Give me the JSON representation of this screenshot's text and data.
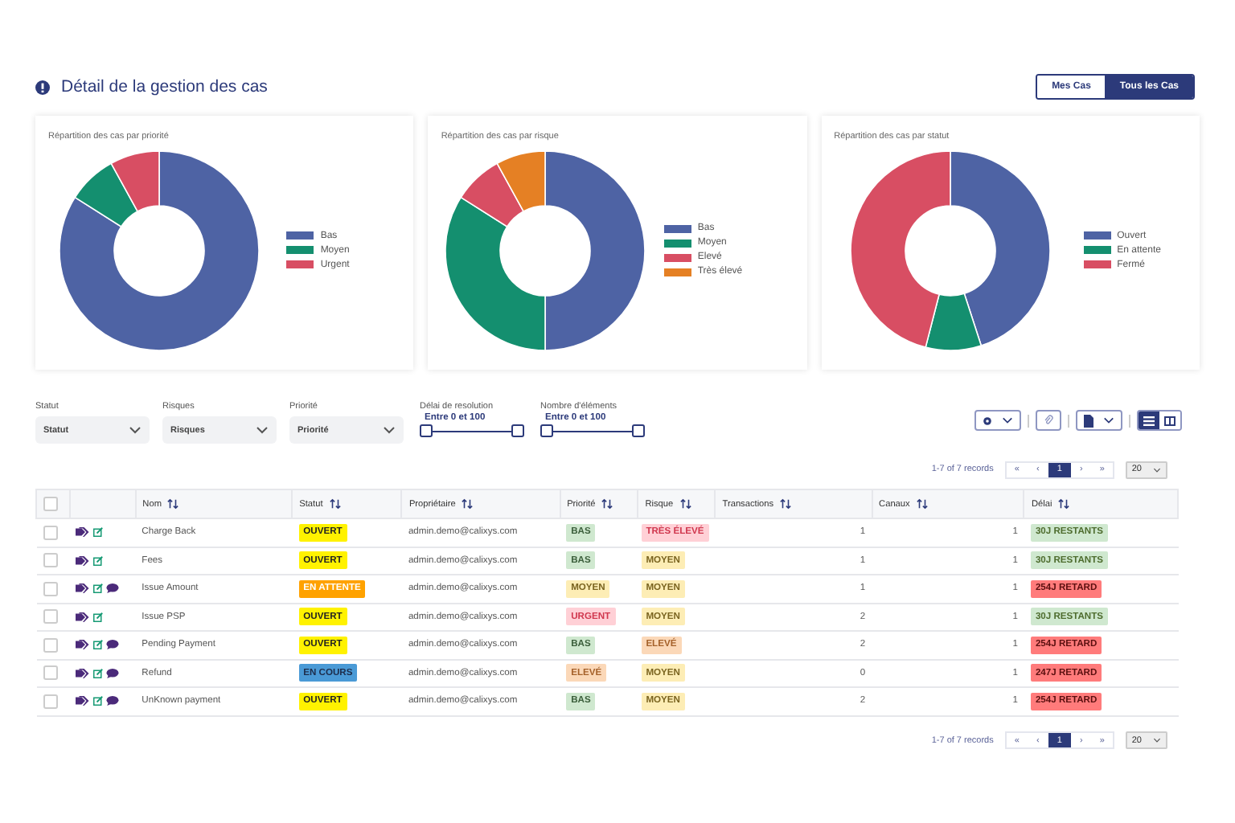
{
  "header": {
    "title": "Détail de la gestion des cas",
    "toggle": [
      {
        "label": "Mes Cas",
        "selected": false
      },
      {
        "label": "Tous les Cas",
        "selected": true
      }
    ]
  },
  "charts": [
    {
      "title": "Répartition des cas par priorité",
      "chart_data": {
        "type": "donut",
        "categories": [
          "Bas",
          "Moyen",
          "Urgent"
        ],
        "values": [
          84,
          8,
          8
        ],
        "colors": [
          "#4e63a4",
          "#148f6f",
          "#d84e63"
        ]
      }
    },
    {
      "title": "Répartition des cas par risque",
      "chart_data": {
        "type": "donut",
        "categories": [
          "Bas",
          "Moyen",
          "Elevé",
          "Très élevé"
        ],
        "values": [
          50,
          34,
          8,
          8
        ],
        "colors": [
          "#4e63a4",
          "#148f6f",
          "#d84e63",
          "#e58024"
        ]
      }
    },
    {
      "title": "Répartition des cas par statut",
      "chart_data": {
        "type": "donut",
        "categories": [
          "Ouvert",
          "En attente",
          "Fermé"
        ],
        "values": [
          45,
          9,
          46
        ],
        "colors": [
          "#4e63a4",
          "#148f6f",
          "#d84e63"
        ]
      }
    }
  ],
  "filters": [
    {
      "kind": "select",
      "label": "Statut",
      "value": "Statut"
    },
    {
      "kind": "select",
      "label": "Risques",
      "value": "Risques"
    },
    {
      "kind": "select",
      "label": "Priorité",
      "value": "Priorité"
    },
    {
      "kind": "range",
      "label": "Délai de resolution",
      "reading": "Entre 0 et 100",
      "thumbs": [
        {
          "level": 0
        },
        {
          "level": 1
        }
      ]
    },
    {
      "kind": "range",
      "label": "Nombre d'éléments",
      "reading": "Entre 0 et 100",
      "thumbs": [
        {
          "level": 0
        },
        {
          "level": 1
        }
      ]
    }
  ],
  "toolbar": {
    "views": [
      {
        "kind": "list",
        "selected": true
      },
      {
        "kind": "columns",
        "selected": false
      }
    ]
  },
  "pager_top": {
    "info": "1-7 of 7 records",
    "buttons": [
      {
        "label": "«",
        "selected": false
      },
      {
        "label": "‹",
        "selected": false
      },
      {
        "label": "1",
        "selected": true
      },
      {
        "label": "›",
        "selected": false
      },
      {
        "label": "»",
        "selected": false
      }
    ],
    "page_size": "20"
  },
  "table": {
    "select_all": {
      "checked": false
    },
    "columns": [
      "Nom",
      "Statut",
      "Propriétaire",
      "Priorité",
      "Risque",
      "Transactions",
      "Canaux",
      "Délai"
    ],
    "rows": [
      {
        "checked": false,
        "comment": false,
        "name": "Charge Back",
        "status": {
          "label": "OUVERT",
          "kind": "open"
        },
        "owner": "admin.demo@calixys.com",
        "priority": {
          "label": "BAS",
          "kind": "low"
        },
        "risk": {
          "label": "TRÈS ÉLEVÉ",
          "kind": "very_high"
        },
        "transactions": "1",
        "channels": "1",
        "deadline": {
          "label": "30J RESTANTS",
          "kind": "remaining"
        }
      },
      {
        "checked": false,
        "comment": false,
        "name": "Fees",
        "status": {
          "label": "OUVERT",
          "kind": "open"
        },
        "owner": "admin.demo@calixys.com",
        "priority": {
          "label": "BAS",
          "kind": "low"
        },
        "risk": {
          "label": "MOYEN",
          "kind": "medium"
        },
        "transactions": "1",
        "channels": "1",
        "deadline": {
          "label": "30J RESTANTS",
          "kind": "remaining"
        }
      },
      {
        "checked": false,
        "comment": true,
        "name": "Issue Amount",
        "status": {
          "label": "EN ATTENTE",
          "kind": "waiting"
        },
        "owner": "admin.demo@calixys.com",
        "priority": {
          "label": "MOYEN",
          "kind": "medium"
        },
        "risk": {
          "label": "MOYEN",
          "kind": "medium"
        },
        "transactions": "1",
        "channels": "1",
        "deadline": {
          "label": "254J RETARD",
          "kind": "late"
        }
      },
      {
        "checked": false,
        "comment": false,
        "name": "Issue PSP",
        "status": {
          "label": "OUVERT",
          "kind": "open"
        },
        "owner": "admin.demo@calixys.com",
        "priority": {
          "label": "URGENT",
          "kind": "urgent"
        },
        "risk": {
          "label": "MOYEN",
          "kind": "medium"
        },
        "transactions": "2",
        "channels": "1",
        "deadline": {
          "label": "30J RESTANTS",
          "kind": "remaining"
        }
      },
      {
        "checked": false,
        "comment": true,
        "name": "Pending Payment",
        "status": {
          "label": "OUVERT",
          "kind": "open"
        },
        "owner": "admin.demo@calixys.com",
        "priority": {
          "label": "BAS",
          "kind": "low"
        },
        "risk": {
          "label": "ELEVÉ",
          "kind": "high"
        },
        "transactions": "2",
        "channels": "1",
        "deadline": {
          "label": "254J RETARD",
          "kind": "late"
        }
      },
      {
        "checked": false,
        "comment": true,
        "name": "Refund",
        "status": {
          "label": "EN COURS",
          "kind": "in_progress"
        },
        "owner": "admin.demo@calixys.com",
        "priority": {
          "label": "ELEVÉ",
          "kind": "high"
        },
        "risk": {
          "label": "MOYEN",
          "kind": "medium"
        },
        "transactions": "0",
        "channels": "1",
        "deadline": {
          "label": "247J RETARD",
          "kind": "late"
        }
      },
      {
        "checked": false,
        "comment": true,
        "name": "UnKnown payment",
        "status": {
          "label": "OUVERT",
          "kind": "open"
        },
        "owner": "admin.demo@calixys.com",
        "priority": {
          "label": "BAS",
          "kind": "low"
        },
        "risk": {
          "label": "MOYEN",
          "kind": "medium"
        },
        "transactions": "2",
        "channels": "1",
        "deadline": {
          "label": "254J RETARD",
          "kind": "late"
        }
      }
    ]
  },
  "pager_bottom": {
    "info": "1-7 of 7 records",
    "buttons": [
      {
        "label": "«",
        "selected": false
      },
      {
        "label": "‹",
        "selected": false
      },
      {
        "label": "1",
        "selected": true
      },
      {
        "label": "›",
        "selected": false
      },
      {
        "label": "»",
        "selected": false
      }
    ],
    "page_size": "20"
  }
}
